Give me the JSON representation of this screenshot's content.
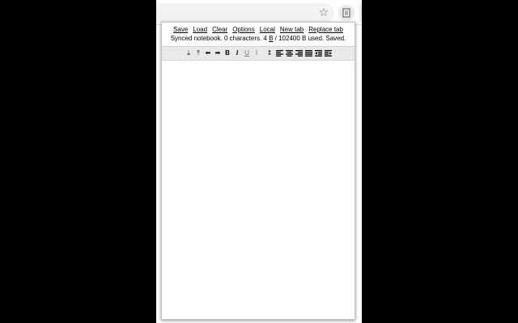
{
  "nav": {
    "links": [
      "Save",
      "Load",
      "Clear",
      "Options",
      "Local",
      "New tab",
      "Replace tab"
    ]
  },
  "status": {
    "prefix": "Synced notebook. 0 characters. 4 ",
    "unit1": "B",
    "middle": " / 102400 ",
    "unit2": "B",
    "suffix": " used. Saved."
  },
  "toolbar": {
    "download_icon": "⤓",
    "upload_icon": "⤒",
    "back_icon": "⬅",
    "forward_icon": "➡",
    "bold": "B",
    "italic": "I",
    "underline": "U",
    "subsup": "⁝",
    "line_height": "↕"
  },
  "browser": {
    "star_icon": "☆"
  }
}
